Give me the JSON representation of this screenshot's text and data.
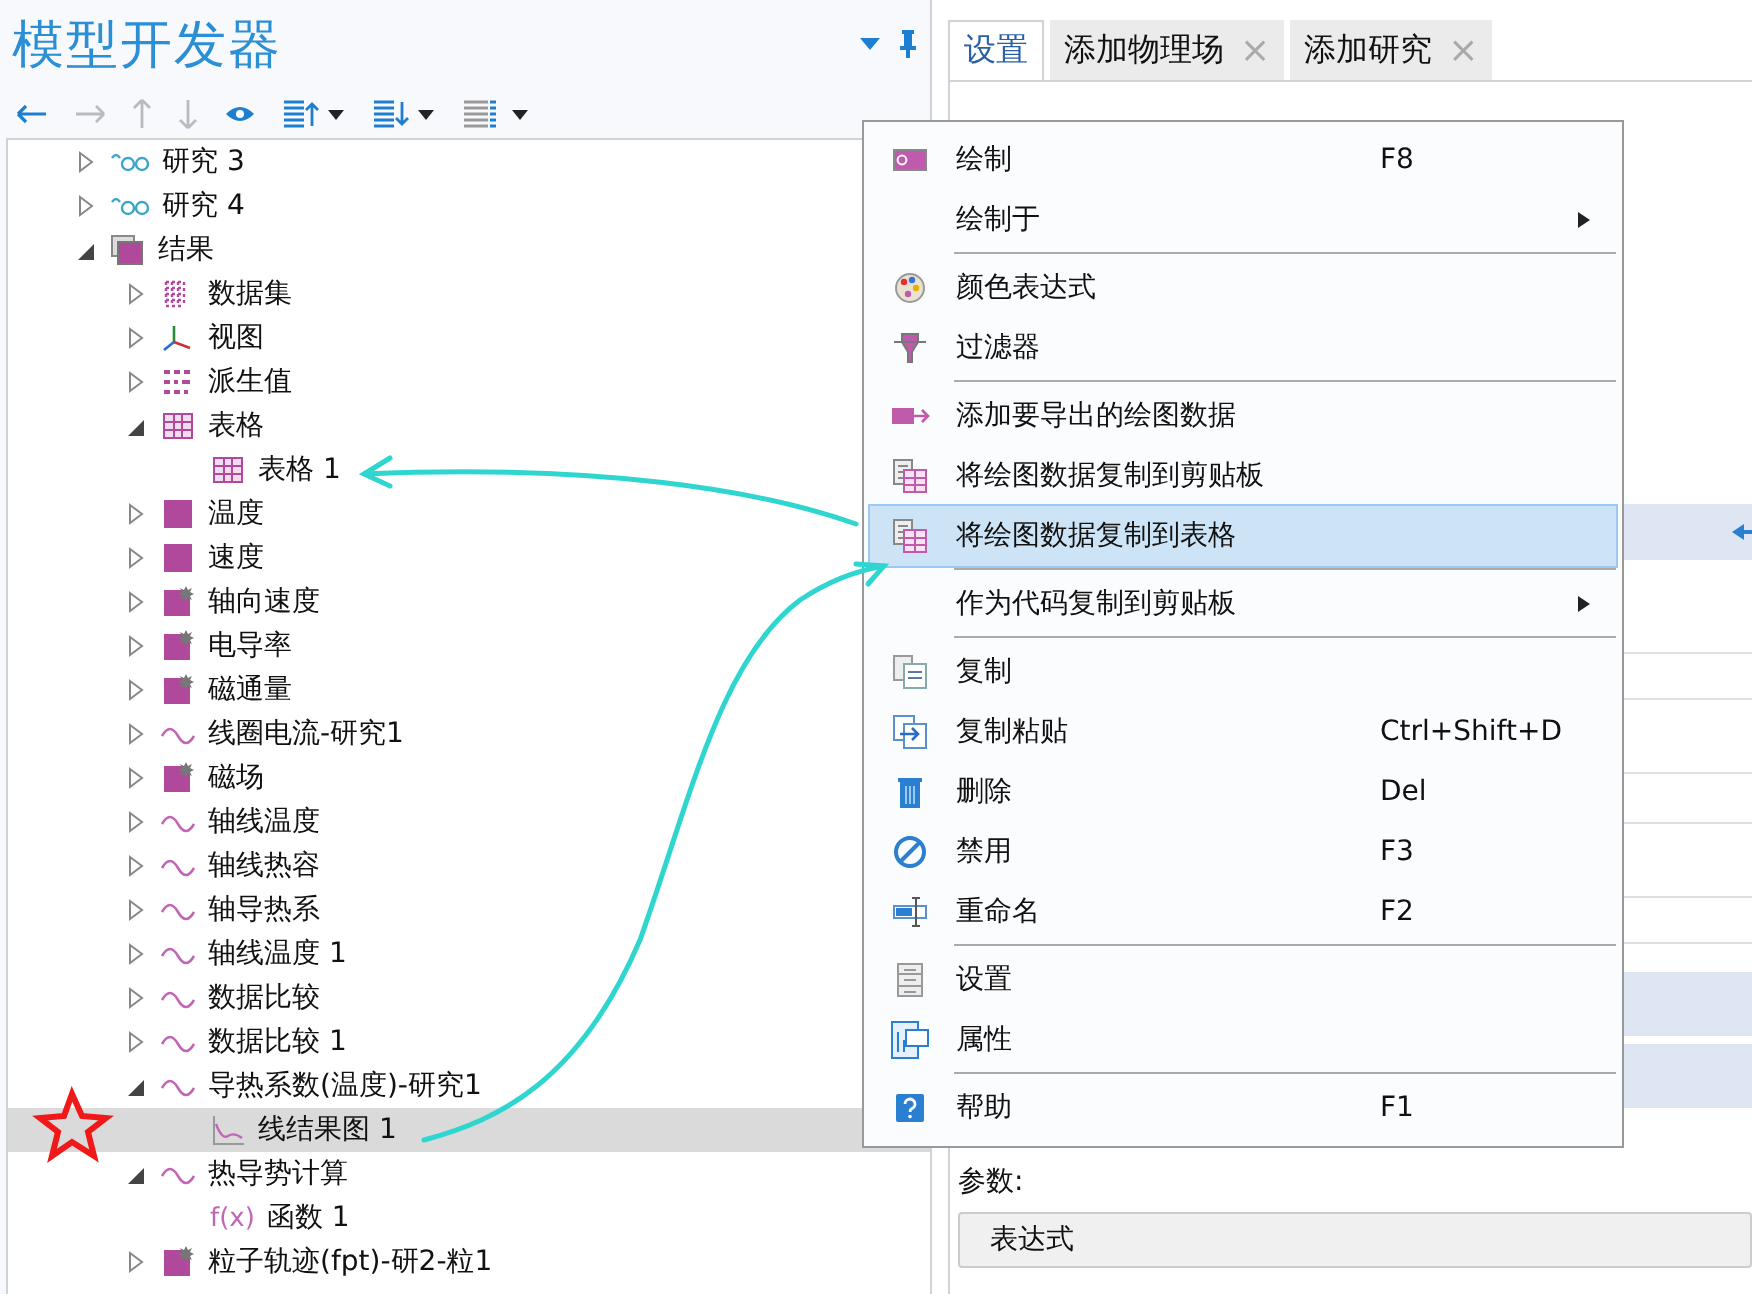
{
  "left_panel": {
    "title": "模型开发器",
    "toolbar": [
      {
        "kind": "back",
        "disabled": false
      },
      {
        "kind": "forward",
        "disabled": true
      },
      {
        "kind": "up",
        "disabled": true
      },
      {
        "kind": "down",
        "disabled": true
      },
      {
        "kind": "eye",
        "disabled": false
      },
      {
        "kind": "list-up",
        "disabled": false
      },
      {
        "kind": "list-down",
        "disabled": false
      },
      {
        "kind": "list",
        "disabled": false
      }
    ],
    "tree": [
      {
        "label": "研究 3",
        "kind": "study",
        "expanded": false,
        "selected": false
      },
      {
        "label": "研究 4",
        "kind": "study",
        "expanded": false,
        "selected": false
      },
      {
        "label": "结果",
        "kind": "results",
        "expanded": true,
        "selected": false,
        "children": [
          {
            "label": "数据集",
            "kind": "dataset",
            "expanded": false,
            "selected": false
          },
          {
            "label": "视图",
            "kind": "view",
            "expanded": false,
            "selected": false
          },
          {
            "label": "派生值",
            "kind": "derived",
            "expanded": false,
            "selected": false
          },
          {
            "label": "表格",
            "kind": "table",
            "expanded": true,
            "selected": false,
            "children": [
              {
                "label": "表格 1",
                "kind": "table",
                "selected": false
              }
            ]
          },
          {
            "label": "温度",
            "kind": "plot2d",
            "expanded": false,
            "selected": false
          },
          {
            "label": "速度",
            "kind": "plot2d",
            "expanded": false,
            "selected": false
          },
          {
            "label": "轴向速度",
            "kind": "plot2d-star",
            "expanded": false,
            "selected": false
          },
          {
            "label": "电导率",
            "kind": "plot2d-star",
            "expanded": false,
            "selected": false
          },
          {
            "label": "磁通量",
            "kind": "plot2d-star",
            "expanded": false,
            "selected": false
          },
          {
            "label": "线圈电流-研究1",
            "kind": "plot1d",
            "expanded": false,
            "selected": false
          },
          {
            "label": "磁场",
            "kind": "plot2d-star",
            "expanded": false,
            "selected": false
          },
          {
            "label": "轴线温度",
            "kind": "plot1d",
            "expanded": false,
            "selected": false
          },
          {
            "label": "轴线热容",
            "kind": "plot1d",
            "expanded": false,
            "selected": false
          },
          {
            "label": "轴导热系",
            "kind": "plot1d",
            "expanded": false,
            "selected": false
          },
          {
            "label": "轴线温度 1",
            "kind": "plot1d",
            "expanded": false,
            "selected": false
          },
          {
            "label": "数据比较",
            "kind": "plot1d",
            "expanded": false,
            "selected": false
          },
          {
            "label": "数据比较 1",
            "kind": "plot1d",
            "expanded": false,
            "selected": false
          },
          {
            "label": "导热系数(温度)-研究1",
            "kind": "plot1d",
            "expanded": true,
            "selected": false,
            "children": [
              {
                "label": "线结果图 1",
                "kind": "line-graph",
                "selected": true
              }
            ]
          },
          {
            "label": "热导势计算",
            "kind": "plot1d",
            "expanded": true,
            "selected": false,
            "children": [
              {
                "label": "函数 1",
                "kind": "function",
                "glyph": "f(x)",
                "selected": false
              }
            ]
          },
          {
            "label": "粒子轨迹(fpt)-研2-粒1",
            "kind": "plot2d-star",
            "expanded": false,
            "selected": false
          }
        ]
      }
    ]
  },
  "right_panel": {
    "tabs": [
      {
        "label": "设置",
        "selected": true,
        "closable": false
      },
      {
        "label": "添加物理场",
        "selected": false,
        "closable": true,
        "close": "×"
      },
      {
        "label": "添加研究",
        "selected": false,
        "closable": true,
        "close": "×"
      }
    ],
    "parameters_label": "参数:",
    "expression_field": {
      "value": "表达式"
    }
  },
  "context_menu": [
    {
      "kind": "plot",
      "label": "绘制",
      "shortcut": "F8",
      "submenu": false,
      "selected": false
    },
    {
      "kind": "none",
      "label": "绘制于",
      "submenu": true,
      "selected": false
    },
    {
      "kind": "separator"
    },
    {
      "kind": "palette",
      "label": "颜色表达式",
      "submenu": false,
      "selected": false
    },
    {
      "kind": "filter",
      "label": "过滤器",
      "submenu": false,
      "selected": false
    },
    {
      "kind": "separator"
    },
    {
      "kind": "export",
      "label": "添加要导出的绘图数据",
      "submenu": false,
      "selected": false
    },
    {
      "kind": "copy-data",
      "label": "将绘图数据复制到剪贴板",
      "submenu": false,
      "selected": false
    },
    {
      "kind": "copy-table",
      "label": "将绘图数据复制到表格",
      "submenu": false,
      "selected": true
    },
    {
      "kind": "separator"
    },
    {
      "kind": "none",
      "label": "作为代码复制到剪贴板",
      "submenu": true,
      "selected": false
    },
    {
      "kind": "separator"
    },
    {
      "kind": "copy",
      "label": "复制",
      "submenu": false,
      "selected": false
    },
    {
      "kind": "duplicate",
      "label": "复制粘贴",
      "shortcut": "Ctrl+Shift+D",
      "submenu": false,
      "selected": false
    },
    {
      "kind": "delete",
      "label": "删除",
      "shortcut": "Del",
      "submenu": false,
      "selected": false
    },
    {
      "kind": "disable",
      "label": "禁用",
      "shortcut": "F3",
      "submenu": false,
      "selected": false
    },
    {
      "kind": "rename",
      "label": "重命名",
      "shortcut": "F2",
      "submenu": false,
      "selected": false
    },
    {
      "kind": "separator"
    },
    {
      "kind": "settings",
      "label": "设置",
      "submenu": false,
      "selected": false
    },
    {
      "kind": "properties",
      "label": "属性",
      "submenu": false,
      "selected": false
    },
    {
      "kind": "separator"
    },
    {
      "kind": "help",
      "label": "帮助",
      "shortcut": "F1",
      "submenu": false,
      "selected": false
    }
  ]
}
